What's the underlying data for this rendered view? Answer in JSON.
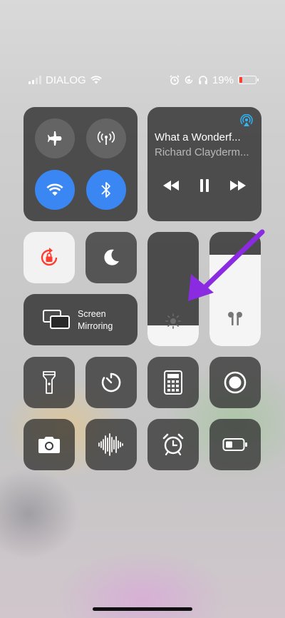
{
  "status_bar": {
    "carrier": "DIALOG",
    "battery_percent": "19%",
    "battery_level": 0.19,
    "icons": [
      "signal-icon",
      "wifi-icon",
      "alarm-icon",
      "orientation-lock-icon",
      "headphones-icon",
      "battery-icon"
    ]
  },
  "connectivity": {
    "airplane": {
      "icon": "airplane-icon",
      "on": false
    },
    "cellular": {
      "icon": "cellular-data-icon",
      "on": false
    },
    "wifi": {
      "icon": "wifi-icon",
      "on": true
    },
    "bluetooth": {
      "icon": "bluetooth-icon",
      "on": true
    },
    "accent": "#3a87f3"
  },
  "now_playing": {
    "title": "What a Wonderf...",
    "artist": "Richard Clayderm...",
    "airplay_icon": "airplay-icon",
    "controls": [
      "rewind-icon",
      "pause-icon",
      "fast-forward-icon"
    ]
  },
  "toggles": {
    "orientation_lock": {
      "icon": "orientation-lock-icon",
      "on": true,
      "color": "#ff3b30"
    },
    "do_not_disturb": {
      "icon": "moon-icon",
      "on": false
    }
  },
  "screen_mirroring": {
    "label_line1": "Screen",
    "label_line2": "Mirroring",
    "icon": "screen-mirroring-icon"
  },
  "brightness": {
    "level": 0.18,
    "icon": "sun-icon"
  },
  "volume": {
    "level": 0.8,
    "icon": "airpods-icon"
  },
  "row3": [
    "flashlight-icon",
    "timer-icon",
    "calculator-icon",
    "screen-record-icon"
  ],
  "row4": [
    "camera-icon",
    "voice-memos-icon",
    "alarm-clock-icon",
    "low-power-mode-icon"
  ],
  "annotation": {
    "arrow_color": "#8a2be2"
  }
}
